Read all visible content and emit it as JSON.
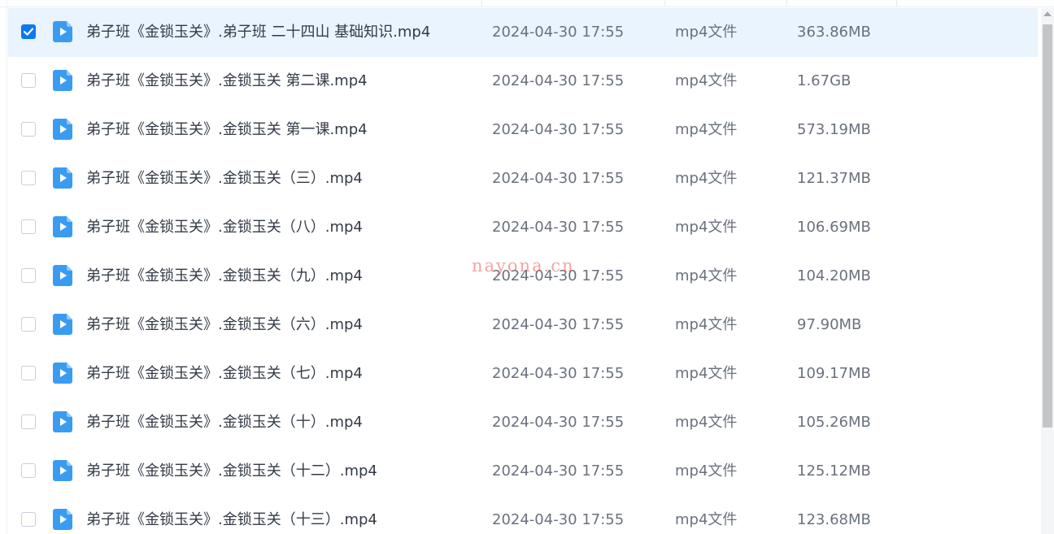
{
  "theme": {
    "selected_row_bg": "#e9f4fe",
    "checkbox_checked": "#0a79f2",
    "video_icon_color": "#3a9cf1",
    "watermark_color": "#e95a5a"
  },
  "icons": {
    "file": "video-file-icon",
    "check": "checkmark-icon"
  },
  "watermark": "nayona.cn",
  "files": [
    {
      "name": "弟子班《金锁玉关》.弟子班  二十四山 基础知识.mp4",
      "modified": "2024-04-30 17:55",
      "type": "mp4文件",
      "size": "363.86MB",
      "selected": true
    },
    {
      "name": "弟子班《金锁玉关》.金锁玉关  第二课.mp4",
      "modified": "2024-04-30 17:55",
      "type": "mp4文件",
      "size": "1.67GB",
      "selected": false
    },
    {
      "name": "弟子班《金锁玉关》.金锁玉关  第一课.mp4",
      "modified": "2024-04-30 17:55",
      "type": "mp4文件",
      "size": "573.19MB",
      "selected": false
    },
    {
      "name": "弟子班《金锁玉关》.金锁玉关（三）.mp4",
      "modified": "2024-04-30 17:55",
      "type": "mp4文件",
      "size": "121.37MB",
      "selected": false
    },
    {
      "name": "弟子班《金锁玉关》.金锁玉关（八）.mp4",
      "modified": "2024-04-30 17:55",
      "type": "mp4文件",
      "size": "106.69MB",
      "selected": false
    },
    {
      "name": "弟子班《金锁玉关》.金锁玉关（九）.mp4",
      "modified": "2024-04-30 17:55",
      "type": "mp4文件",
      "size": "104.20MB",
      "selected": false
    },
    {
      "name": "弟子班《金锁玉关》.金锁玉关（六）.mp4",
      "modified": "2024-04-30 17:55",
      "type": "mp4文件",
      "size": "97.90MB",
      "selected": false
    },
    {
      "name": "弟子班《金锁玉关》.金锁玉关（七）.mp4",
      "modified": "2024-04-30 17:55",
      "type": "mp4文件",
      "size": "109.17MB",
      "selected": false
    },
    {
      "name": "弟子班《金锁玉关》.金锁玉关（十）.mp4",
      "modified": "2024-04-30 17:55",
      "type": "mp4文件",
      "size": "105.26MB",
      "selected": false
    },
    {
      "name": "弟子班《金锁玉关》.金锁玉关（十二）.mp4",
      "modified": "2024-04-30 17:55",
      "type": "mp4文件",
      "size": "125.12MB",
      "selected": false
    },
    {
      "name": "弟子班《金锁玉关》.金锁玉关（十三）.mp4",
      "modified": "2024-04-30 17:55",
      "type": "mp4文件",
      "size": "123.68MB",
      "selected": false
    }
  ]
}
